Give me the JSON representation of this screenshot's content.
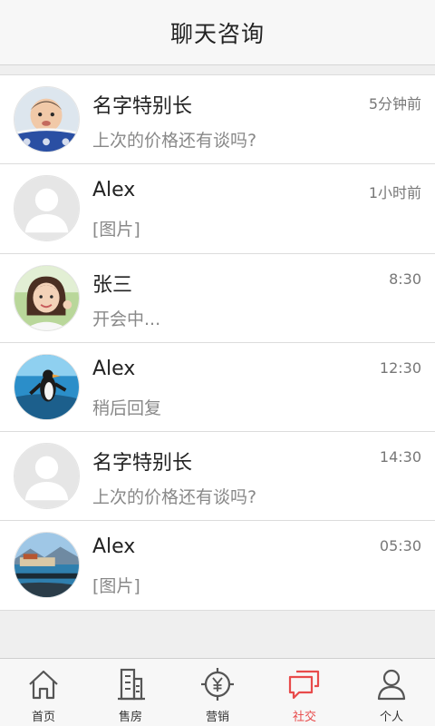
{
  "header": {
    "title": "聊天咨询"
  },
  "conversations": [
    {
      "name": "名字特别长",
      "message": "上次的价格还有谈吗?",
      "time": "5分钟前",
      "avatar": "baby-photo"
    },
    {
      "name": "Alex",
      "message": "[图片]",
      "time": "1小时前",
      "avatar": "default-user"
    },
    {
      "name": "张三",
      "message": "开会中...",
      "time": "8:30",
      "avatar": "girl-photo"
    },
    {
      "name": "Alex",
      "message": "稍后回复",
      "time": "12:30",
      "avatar": "penguin-photo"
    },
    {
      "name": "名字特别长",
      "message": "上次的价格还有谈吗?",
      "time": "14:30",
      "avatar": "default-user"
    },
    {
      "name": "Alex",
      "message": "[图片]",
      "time": "05:30",
      "avatar": "beach-photo"
    }
  ],
  "tabbar": {
    "items": [
      {
        "label": "首页",
        "icon": "home-icon"
      },
      {
        "label": "售房",
        "icon": "building-icon"
      },
      {
        "label": "营销",
        "icon": "yuan-target-icon"
      },
      {
        "label": "社交",
        "icon": "chat-bubbles-icon",
        "active": true
      },
      {
        "label": "个人",
        "icon": "person-icon"
      }
    ]
  },
  "colors": {
    "accent": "#e84b4b",
    "text": "#222222",
    "muted": "#888888"
  }
}
